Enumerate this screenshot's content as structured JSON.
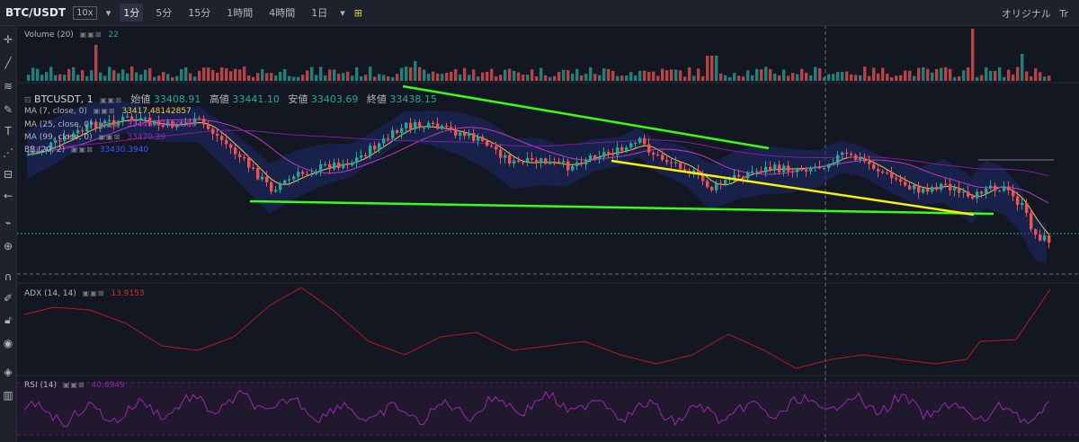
{
  "header": {
    "symbol": "BTC/USDT",
    "leverage": "10x",
    "timeframes": [
      "1分",
      "5分",
      "15分",
      "1時間",
      "4時間",
      "1日"
    ],
    "active_timeframe": "1分",
    "chart_style_label": "オリジナル",
    "right_extra": "Tr"
  },
  "volume": {
    "label": "Volume (20)",
    "value": "22"
  },
  "price": {
    "title": "BTCUSDT, 1",
    "open_label": "始値",
    "open": "33408.91",
    "high_label": "高値",
    "high": "33441.10",
    "low_label": "安値",
    "low": "33403.69",
    "close_label": "終値",
    "close": "33438.15"
  },
  "indicators": {
    "ma7_label": "MA (7, close, 0)",
    "ma7_value": "33417.48142857",
    "ma25_label": "MA (25, close, 0)",
    "ma25_value": "33446.42400000",
    "ma99_label": "MA (99, close, 0)",
    "ma99_value": "33470.39",
    "bb_label": "BB (20, 2)",
    "bb_value": "33430.3940"
  },
  "adx": {
    "label": "ADX (14, 14)",
    "value": "13.9153"
  },
  "rsi": {
    "label": "RSI (14)",
    "value": "40.6949"
  },
  "colors": {
    "up": "#26a69a",
    "down": "#ef5350",
    "bg": "#131722",
    "trend_green": "#39ff14",
    "trend_yellow": "#f9f200"
  },
  "toolbar_icons": [
    "crosshair-icon",
    "trend-line-icon",
    "fib-icon",
    "brush-icon",
    "text-icon",
    "pattern-icon",
    "measure-icon",
    "ruler-icon",
    "zoom-icon",
    "magnet-icon",
    "lock-icon",
    "eye-icon",
    "layers-icon",
    "trash-icon"
  ]
}
